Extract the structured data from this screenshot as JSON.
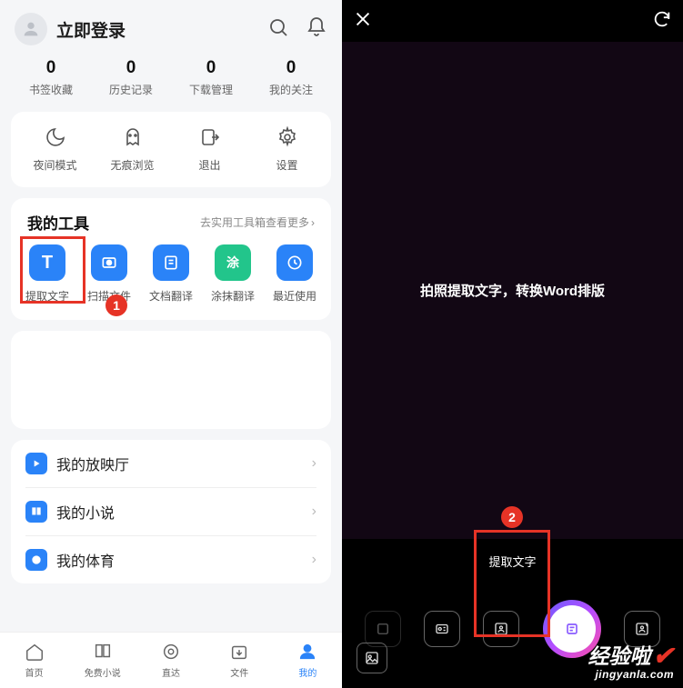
{
  "left": {
    "login_label": "立即登录",
    "stats": [
      {
        "n": "0",
        "l": "书签收藏"
      },
      {
        "n": "0",
        "l": "历史记录"
      },
      {
        "n": "0",
        "l": "下载管理"
      },
      {
        "n": "0",
        "l": "我的关注"
      }
    ],
    "quick": [
      {
        "l": "夜间模式"
      },
      {
        "l": "无痕浏览"
      },
      {
        "l": "退出"
      },
      {
        "l": "设置"
      }
    ],
    "tools": {
      "title": "我的工具",
      "more": "去实用工具箱查看更多",
      "items": [
        {
          "l": "提取文字",
          "glyph": "T"
        },
        {
          "l": "扫描文件",
          "glyph": ""
        },
        {
          "l": "文档翻译",
          "glyph": ""
        },
        {
          "l": "涂抹翻译",
          "glyph": ""
        },
        {
          "l": "最近使用",
          "glyph": ""
        }
      ]
    },
    "list": [
      {
        "l": "我的放映厅"
      },
      {
        "l": "我的小说"
      },
      {
        "l": "我的体育"
      }
    ],
    "tabs": [
      {
        "l": "首页"
      },
      {
        "l": "免费小说"
      },
      {
        "l": "直达"
      },
      {
        "l": "文件"
      },
      {
        "l": "我的"
      }
    ]
  },
  "right": {
    "hint": "拍照提取文字，转换Word排版",
    "mode": "提取文字"
  },
  "badges": {
    "b1": "1",
    "b2": "2"
  },
  "watermark": {
    "l1": "经验啦",
    "l2": "jingyanla.com"
  }
}
